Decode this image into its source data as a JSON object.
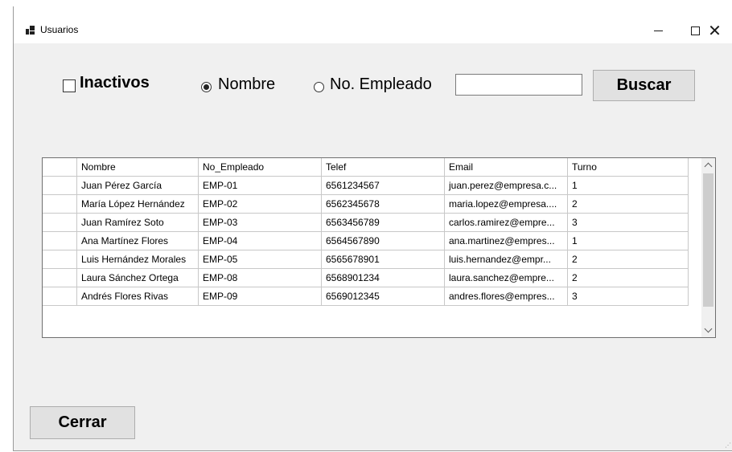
{
  "window": {
    "title": "Usuarios",
    "close_glyph": "✕"
  },
  "filters": {
    "inactive_label": "Inactivos",
    "inactive_checked": false,
    "radio_nombre_label": "Nombre",
    "radio_nombre_checked": true,
    "radio_empleado_label": "No. Empleado",
    "radio_empleado_checked": false,
    "search_value": "",
    "search_button": "Buscar"
  },
  "grid": {
    "columns": [
      "Nombre",
      "No_Empleado",
      "Telef",
      "Email",
      "Turno"
    ],
    "rows": [
      [
        "Juan Pérez García",
        "EMP-01",
        "6561234567",
        "juan.perez@empresa.c...",
        "1"
      ],
      [
        "María López Hernández",
        "EMP-02",
        "6562345678",
        "maria.lopez@empresa....",
        "2"
      ],
      [
        "Juan Ramírez Soto",
        "EMP-03",
        "6563456789",
        "carlos.ramirez@empre...",
        "3"
      ],
      [
        "Ana Martínez Flores",
        "EMP-04",
        "6564567890",
        "ana.martinez@empres...",
        "1"
      ],
      [
        "Luis Hernández Morales",
        "EMP-05",
        "6565678901",
        "luis.hernandez@empr...",
        "2"
      ],
      [
        "Laura Sánchez Ortega",
        "EMP-08",
        "6568901234",
        "laura.sanchez@empre...",
        "2"
      ],
      [
        "Andrés Flores Rivas",
        "EMP-09",
        "6569012345",
        "andres.flores@empres...",
        "3"
      ]
    ]
  },
  "footer": {
    "close_button": "Cerrar"
  },
  "icons": {
    "app": "app-icon",
    "minimize": "minimize-icon",
    "maximize": "maximize-icon",
    "close": "close-icon",
    "scroll_up": "chevron-up-icon",
    "scroll_down": "chevron-down-icon"
  }
}
